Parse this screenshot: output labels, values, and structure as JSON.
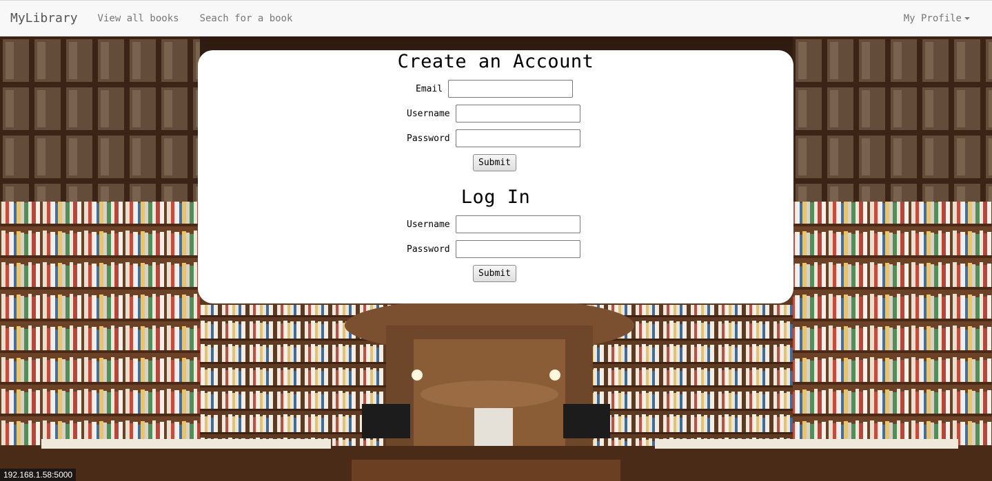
{
  "navbar": {
    "brand": "MyLibrary",
    "links": [
      "View all books",
      "Seach for a book"
    ],
    "profile": "My Profile"
  },
  "create_account": {
    "title": "Create an Account",
    "email_label": "Email",
    "username_label": "Username",
    "password_label": "Password",
    "submit_label": "Submit"
  },
  "login": {
    "title": "Log In",
    "username_label": "Username",
    "password_label": "Password",
    "submit_label": "Submit"
  },
  "status_bar": "192.168.1.58:5000",
  "colors": {
    "navbar_bg": "#f8f8f8",
    "card_bg": "#ffffff",
    "wood": "#5a3520"
  },
  "background_image": "library-bookshelves"
}
